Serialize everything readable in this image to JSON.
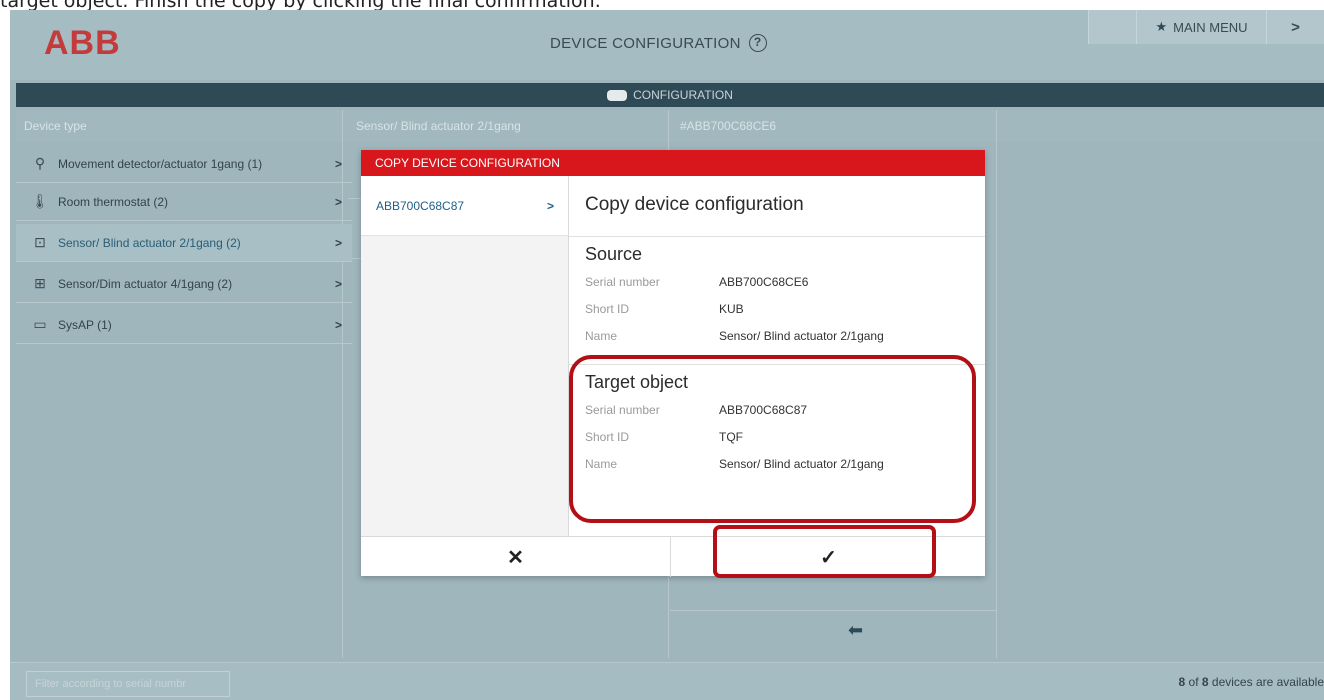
{
  "instruction": "target object. Finish the copy by clicking the final confirmation.",
  "header": {
    "logo": "ABB",
    "title": "DEVICE CONFIGURATION",
    "help_glyph": "?",
    "main_menu_label": "MAIN MENU",
    "next_glyph": ">"
  },
  "config_bar": {
    "label": "CONFIGURATION"
  },
  "columns": {
    "device_type": "Device type",
    "middle": "Sensor/ Blind actuator 2/1gang",
    "right": "#ABB700C68CE6"
  },
  "device_list": [
    {
      "label": "Movement detector/actuator 1gang (1)",
      "icon": "movement-detector-icon",
      "glyph": "⚲",
      "active": false
    },
    {
      "label": "Room thermostat (2)",
      "icon": "thermostat-icon",
      "glyph": "🌡",
      "active": false
    },
    {
      "label": "Sensor/ Blind actuator 2/1gang (2)",
      "icon": "blind-actuator-icon",
      "glyph": "⊡",
      "active": true
    },
    {
      "label": "Sensor/Dim actuator 4/1gang (2)",
      "icon": "dim-actuator-icon",
      "glyph": "⊞",
      "active": false
    },
    {
      "label": "SysAP (1)",
      "icon": "sysap-icon",
      "glyph": "▭",
      "active": false
    }
  ],
  "footer": {
    "filter_placeholder": "Filter according to serial numbr",
    "count_num": "8",
    "count_of": "of",
    "count_total": "8",
    "count_suffix": "devices are available"
  },
  "modal": {
    "title": "COPY DEVICE CONFIGURATION",
    "left_item": "ABB700C68C87",
    "heading": "Copy device configuration",
    "source": {
      "title": "Source",
      "rows": [
        {
          "label": "Serial number",
          "value": "ABB700C68CE6"
        },
        {
          "label": "Short ID",
          "value": "KUB"
        },
        {
          "label": "Name",
          "value": "Sensor/ Blind actuator 2/1gang"
        }
      ]
    },
    "target": {
      "title": "Target object",
      "rows": [
        {
          "label": "Serial number",
          "value": "ABB700C68C87"
        },
        {
          "label": "Short ID",
          "value": "TQF"
        },
        {
          "label": "Name",
          "value": "Sensor/ Blind actuator 2/1gang"
        }
      ]
    },
    "cancel_glyph": "✕",
    "confirm_glyph": "✓"
  },
  "colors": {
    "accent_red": "#d8171d",
    "highlight": "#b30f16",
    "nav_bar": "#2e4a56"
  }
}
